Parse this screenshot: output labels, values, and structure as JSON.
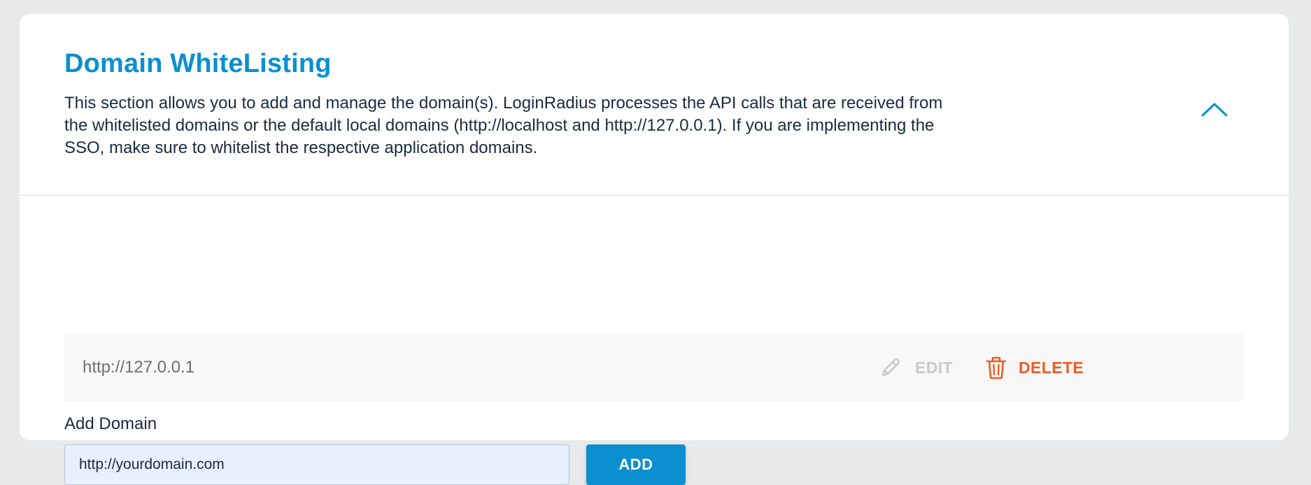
{
  "section": {
    "title": "Domain WhiteListing",
    "description": "This section allows you to add and manage the domain(s). LoginRadius processes the API calls that are received from the whitelisted domains or the default local domains (http://localhost and http://127.0.0.1). If you are implementing the SSO, make sure to whitelist the respective application domains.",
    "toggle_icon": "chevron-up-icon"
  },
  "add_domain": {
    "label": "Add Domain",
    "input_value": "http://yourdomain.com",
    "button_label": "ADD"
  },
  "domains": [
    {
      "value": "http://127.0.0.1",
      "edit_label": "EDIT",
      "edit_icon": "pencil-icon",
      "delete_label": "DELETE",
      "delete_icon": "trash-icon"
    }
  ],
  "colors": {
    "accent": "#0a8fd0",
    "danger": "#ef5b25",
    "disabled": "#c7c9cc",
    "background": "#e8e9eb"
  }
}
